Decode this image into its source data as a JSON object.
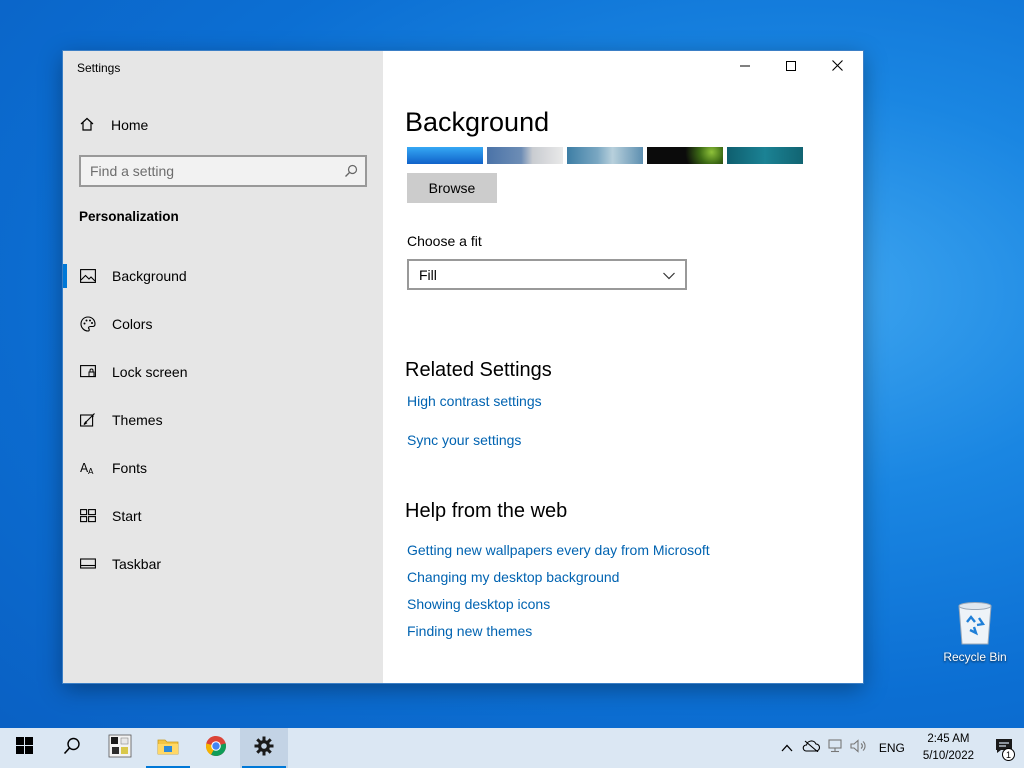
{
  "window": {
    "title": "Settings",
    "home_label": "Home",
    "search_placeholder": "Find a setting",
    "section_label": "Personalization",
    "nav_items": [
      {
        "label": "Background",
        "icon": "picture-icon",
        "selected": true
      },
      {
        "label": "Colors",
        "icon": "palette-icon",
        "selected": false
      },
      {
        "label": "Lock screen",
        "icon": "lock-screen-icon",
        "selected": false
      },
      {
        "label": "Themes",
        "icon": "themes-icon",
        "selected": false
      },
      {
        "label": "Fonts",
        "icon": "fonts-icon",
        "selected": false
      },
      {
        "label": "Start",
        "icon": "start-icon",
        "selected": false
      },
      {
        "label": "Taskbar",
        "icon": "taskbar-icon",
        "selected": false
      }
    ]
  },
  "content": {
    "page_title": "Background",
    "recent_images": [
      {
        "color": "#1c8ee6"
      },
      {
        "color": "#8b9cb0"
      },
      {
        "color": "#5a8fb0"
      },
      {
        "color": "#0d0d0d"
      },
      {
        "color": "#137080"
      }
    ],
    "browse_label": "Browse",
    "fit_label": "Choose a fit",
    "fit_value": "Fill",
    "related_heading": "Related Settings",
    "related_links": [
      "High contrast settings",
      "Sync your settings"
    ],
    "help_heading": "Help from the web",
    "help_links": [
      "Getting new wallpapers every day from Microsoft",
      "Changing my desktop background",
      "Showing desktop icons",
      "Finding new themes"
    ]
  },
  "desktop": {
    "recycle_bin_label": "Recycle Bin"
  },
  "taskbar": {
    "pinned": [
      "start-icon",
      "search-icon",
      "game-icon",
      "file-explorer-icon",
      "chrome-icon",
      "settings-icon"
    ],
    "language": "ENG",
    "time": "2:45 AM",
    "date": "5/10/2022",
    "notification_count": "1"
  },
  "colors": {
    "accent": "#0078d7",
    "link": "#0063b1",
    "sidebar_bg": "#e6e6e6",
    "taskbar_bg": "#dbe7f3"
  }
}
